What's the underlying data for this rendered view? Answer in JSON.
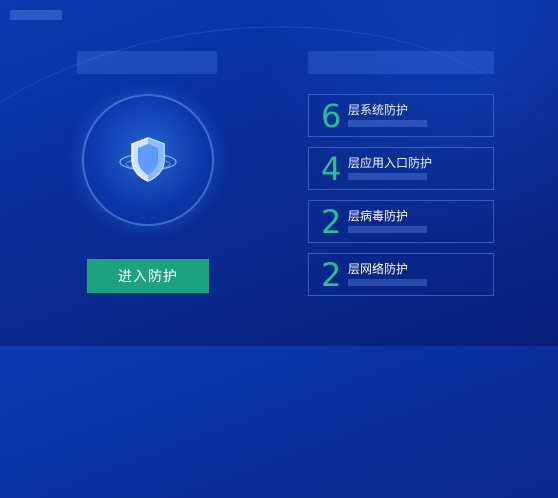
{
  "actions": {
    "enter_label": "进入防护"
  },
  "protection_layers": [
    {
      "count": "6",
      "label": "层系统防护"
    },
    {
      "count": "4",
      "label": "层应用入口防护"
    },
    {
      "count": "2",
      "label": "层病毒防护"
    },
    {
      "count": "2",
      "label": "层网络防护"
    }
  ],
  "colors": {
    "accent_green": "#1aa37e",
    "number_green": "#27c28f",
    "background": "#0a2f9a"
  },
  "icons": {
    "center": "shield-icon"
  }
}
